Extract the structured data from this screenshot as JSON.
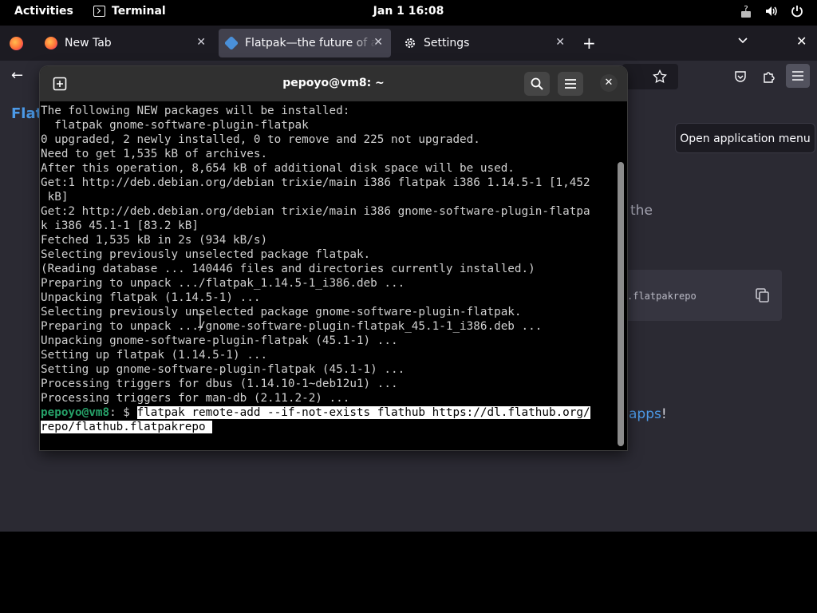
{
  "topbar": {
    "activities": "Activities",
    "app_name": "Terminal",
    "clock": "Jan 1  16:08",
    "tray_icons": [
      "accessibility-icon",
      "volume-icon",
      "power-icon"
    ]
  },
  "firefox": {
    "tabs": [
      {
        "label": "New Tab",
        "icon": "firefox-icon"
      },
      {
        "label": "Flatpak—the future of apps",
        "icon": "flatpak-icon"
      },
      {
        "label": "Settings",
        "icon": "gear-icon"
      }
    ],
    "page_heading_partial": "Flat",
    "page_text_partial": "the",
    "code_partial": ".flatpakrepo",
    "link_partial": "apps",
    "link_suffix": "!",
    "tooltip": "Open application menu"
  },
  "terminal": {
    "title": "pepoyo@vm8: ~",
    "lines": [
      "The following NEW packages will be installed:",
      "  flatpak gnome-software-plugin-flatpak",
      "0 upgraded, 2 newly installed, 0 to remove and 225 not upgraded.",
      "Need to get 1,535 kB of archives.",
      "After this operation, 8,654 kB of additional disk space will be used.",
      "Get:1 http://deb.debian.org/debian trixie/main i386 flatpak i386 1.14.5-1 [1,452",
      " kB]",
      "Get:2 http://deb.debian.org/debian trixie/main i386 gnome-software-plugin-flatpa",
      "k i386 45.1-1 [83.2 kB]",
      "Fetched 1,535 kB in 2s (934 kB/s)",
      "Selecting previously unselected package flatpak.",
      "(Reading database ... 140446 files and directories currently installed.)",
      "Preparing to unpack .../flatpak_1.14.5-1_i386.deb ...",
      "Unpacking flatpak (1.14.5-1) ...",
      "Selecting previously unselected package gnome-software-plugin-flatpak.",
      "Preparing to unpack .../gnome-software-plugin-flatpak_45.1-1_i386.deb ...",
      "Unpacking gnome-software-plugin-flatpak (45.1-1) ...",
      "Setting up flatpak (1.14.5-1) ...",
      "Setting up gnome-software-plugin-flatpak (45.1-1) ...",
      "Processing triggers for dbus (1.14.10-1~deb12u1) ...",
      "Processing triggers for man-db (2.11.2-2) ..."
    ],
    "prompt_user": "pepoyo@vm8",
    "prompt_symbol": ": $ ",
    "command_line1": "flatpak remote-add --if-not-exists flathub https://dl.flathub.org/",
    "command_line2": "repo/flathub.flatpakrepo "
  }
}
